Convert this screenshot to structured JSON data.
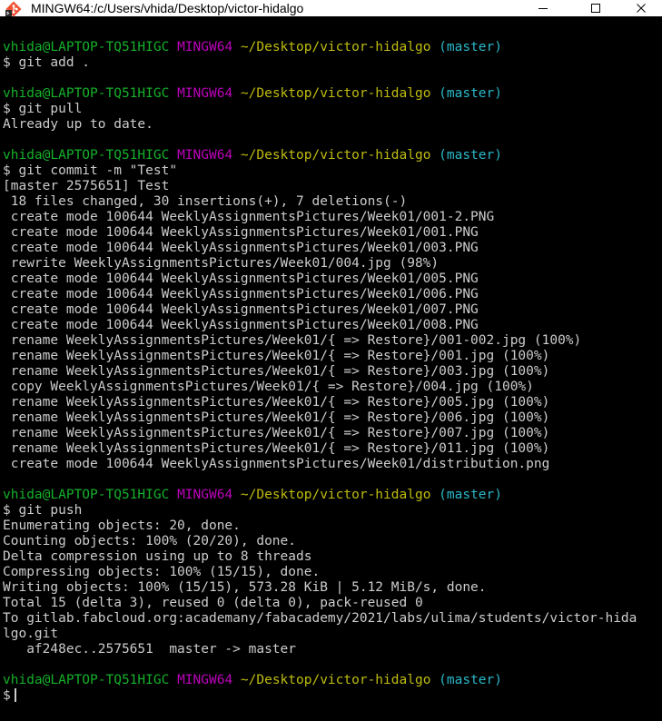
{
  "window": {
    "title": "MINGW64:/c/Users/vhida/Desktop/victor-hidalgo",
    "app_icon": "git-bash-icon",
    "minimize_icon": "minimize-icon",
    "maximize_icon": "maximize-icon",
    "close_icon": "close-icon"
  },
  "colors": {
    "background": "#000000",
    "text": "#cccccc",
    "user_host": "#15b12a",
    "shell": "#bb00bb",
    "path": "#bfbc0e",
    "branch": "#2bb9c8"
  },
  "prompt": {
    "user_host": "vhida@LAPTOP-TQ51HIGC",
    "shell": "MINGW64",
    "path": "~/Desktop/victor-hidalgo",
    "branch": "(master)"
  },
  "lines": [
    {
      "type": "prompt"
    },
    {
      "type": "text",
      "text": "$ git add ."
    },
    {
      "type": "blank"
    },
    {
      "type": "prompt"
    },
    {
      "type": "text",
      "text": "$ git pull"
    },
    {
      "type": "text",
      "text": "Already up to date."
    },
    {
      "type": "blank"
    },
    {
      "type": "prompt"
    },
    {
      "type": "text",
      "text": "$ git commit -m \"Test\""
    },
    {
      "type": "text",
      "text": "[master 2575651] Test"
    },
    {
      "type": "text",
      "text": " 18 files changed, 30 insertions(+), 7 deletions(-)"
    },
    {
      "type": "text",
      "text": " create mode 100644 WeeklyAssignmentsPictures/Week01/001-2.PNG"
    },
    {
      "type": "text",
      "text": " create mode 100644 WeeklyAssignmentsPictures/Week01/001.PNG"
    },
    {
      "type": "text",
      "text": " create mode 100644 WeeklyAssignmentsPictures/Week01/003.PNG"
    },
    {
      "type": "text",
      "text": " rewrite WeeklyAssignmentsPictures/Week01/004.jpg (98%)"
    },
    {
      "type": "text",
      "text": " create mode 100644 WeeklyAssignmentsPictures/Week01/005.PNG"
    },
    {
      "type": "text",
      "text": " create mode 100644 WeeklyAssignmentsPictures/Week01/006.PNG"
    },
    {
      "type": "text",
      "text": " create mode 100644 WeeklyAssignmentsPictures/Week01/007.PNG"
    },
    {
      "type": "text",
      "text": " create mode 100644 WeeklyAssignmentsPictures/Week01/008.PNG"
    },
    {
      "type": "text",
      "text": " rename WeeklyAssignmentsPictures/Week01/{ => Restore}/001-002.jpg (100%)"
    },
    {
      "type": "text",
      "text": " rename WeeklyAssignmentsPictures/Week01/{ => Restore}/001.jpg (100%)"
    },
    {
      "type": "text",
      "text": " rename WeeklyAssignmentsPictures/Week01/{ => Restore}/003.jpg (100%)"
    },
    {
      "type": "text",
      "text": " copy WeeklyAssignmentsPictures/Week01/{ => Restore}/004.jpg (100%)"
    },
    {
      "type": "text",
      "text": " rename WeeklyAssignmentsPictures/Week01/{ => Restore}/005.jpg (100%)"
    },
    {
      "type": "text",
      "text": " rename WeeklyAssignmentsPictures/Week01/{ => Restore}/006.jpg (100%)"
    },
    {
      "type": "text",
      "text": " rename WeeklyAssignmentsPictures/Week01/{ => Restore}/007.jpg (100%)"
    },
    {
      "type": "text",
      "text": " rename WeeklyAssignmentsPictures/Week01/{ => Restore}/011.jpg (100%)"
    },
    {
      "type": "text",
      "text": " create mode 100644 WeeklyAssignmentsPictures/Week01/distribution.png"
    },
    {
      "type": "blank"
    },
    {
      "type": "prompt"
    },
    {
      "type": "text",
      "text": "$ git push"
    },
    {
      "type": "text",
      "text": "Enumerating objects: 20, done."
    },
    {
      "type": "text",
      "text": "Counting objects: 100% (20/20), done."
    },
    {
      "type": "text",
      "text": "Delta compression using up to 8 threads"
    },
    {
      "type": "text",
      "text": "Compressing objects: 100% (15/15), done."
    },
    {
      "type": "text",
      "text": "Writing objects: 100% (15/15), 573.28 KiB | 5.12 MiB/s, done."
    },
    {
      "type": "text",
      "text": "Total 15 (delta 3), reused 0 (delta 0), pack-reused 0"
    },
    {
      "type": "text",
      "text": "To gitlab.fabcloud.org:academany/fabacademy/2021/labs/ulima/students/victor-hida"
    },
    {
      "type": "text",
      "text": "lgo.git"
    },
    {
      "type": "text",
      "text": "   af248ec..2575651  master -> master"
    },
    {
      "type": "blank"
    },
    {
      "type": "prompt"
    },
    {
      "type": "input",
      "text": "$"
    }
  ]
}
